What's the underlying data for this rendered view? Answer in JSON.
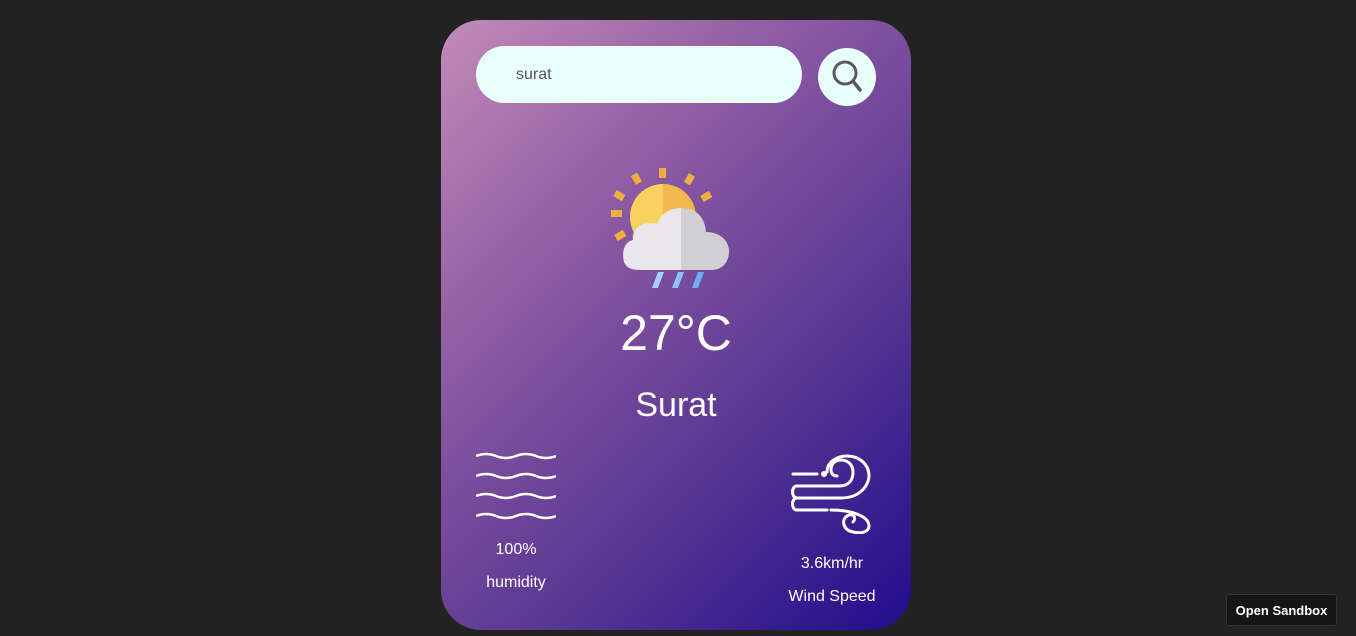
{
  "search": {
    "value": "surat",
    "icon": "search-icon"
  },
  "weather": {
    "icon": "sun-cloud-rain-icon",
    "temperature": "27°C",
    "city": "Surat"
  },
  "humidity": {
    "icon": "humidity-waves-icon",
    "value": "100%",
    "label": "humidity"
  },
  "wind": {
    "icon": "wind-icon",
    "value": "3.6km/hr",
    "label": "Wind Speed"
  },
  "sandbox": {
    "label": "Open Sandbox"
  }
}
